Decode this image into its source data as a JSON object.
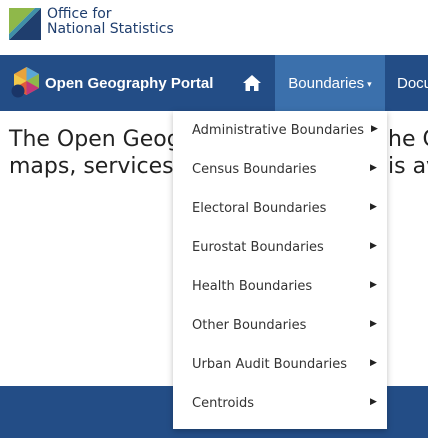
{
  "ons": {
    "line1": "Office for",
    "line2": "National Statistics"
  },
  "nav": {
    "portal_title": "Open Geography Portal",
    "home_icon": "home-icon",
    "boundaries_label": "Boundaries",
    "boundaries_caret": "▾",
    "docs_label": "Docu"
  },
  "intro": {
    "line1": "The Open Geog",
    "line1_right": "he C",
    "line2": "maps, services a",
    "line2_right": "is av"
  },
  "dropdown": {
    "items": [
      {
        "label": "Administrative Boundaries",
        "arrow": "▶"
      },
      {
        "label": "Census Boundaries",
        "arrow": "▶"
      },
      {
        "label": "Electoral Boundaries",
        "arrow": "▶"
      },
      {
        "label": "Eurostat Boundaries",
        "arrow": "▶"
      },
      {
        "label": "Health Boundaries",
        "arrow": "▶"
      },
      {
        "label": "Other Boundaries",
        "arrow": "▶"
      },
      {
        "label": "Urban Audit Boundaries",
        "arrow": "▶"
      },
      {
        "label": "Centroids",
        "arrow": "▶"
      }
    ]
  },
  "colors": {
    "navbar": "#234d86",
    "active_tab": "#3b70ac",
    "ons_text": "#1f3e6e"
  }
}
